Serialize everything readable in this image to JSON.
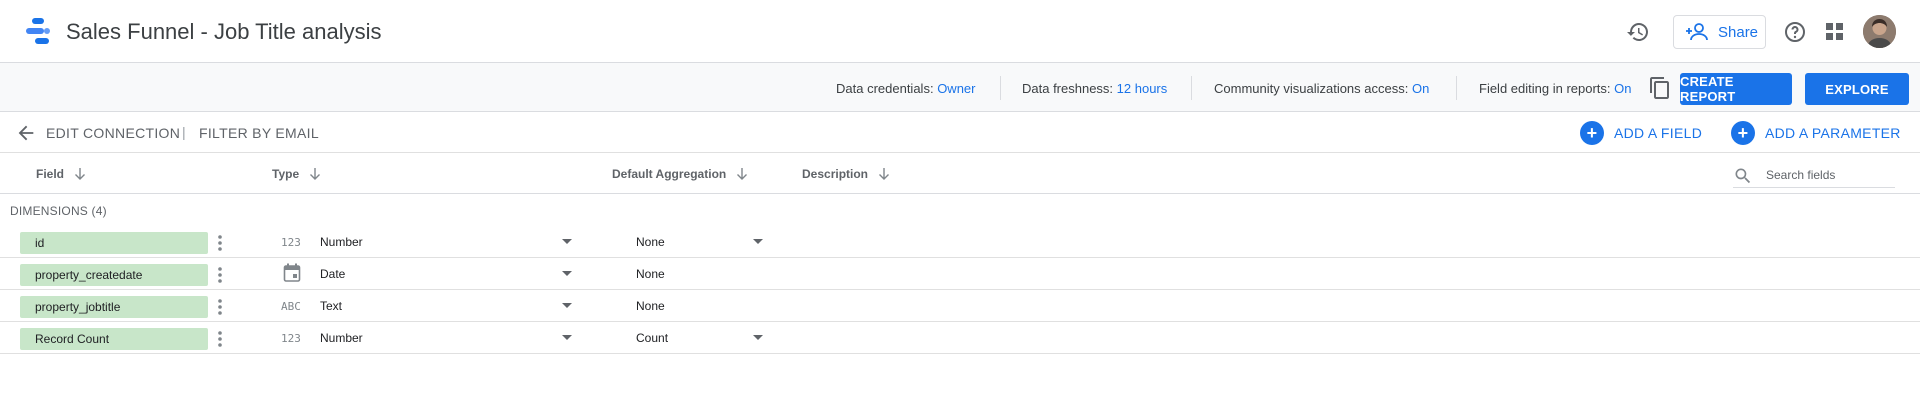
{
  "header": {
    "title": "Sales Funnel - Job Title analysis",
    "share_label": "Share",
    "icons": [
      "history-icon",
      "help-icon",
      "apps-grid-icon"
    ]
  },
  "infobar": {
    "credentials_label": "Data credentials:",
    "credentials_value": "Owner",
    "freshness_label": "Data freshness:",
    "freshness_value": "12 hours",
    "community_label": "Community visualizations access:",
    "community_value": "On",
    "field_editing_label": "Field editing in reports:",
    "field_editing_value": "On",
    "create_report_label": "CREATE REPORT",
    "explore_label": "EXPLORE"
  },
  "connection": {
    "edit_label": "EDIT CONNECTION",
    "separator": "|",
    "filter_label": "FILTER BY EMAIL",
    "add_field_label": "ADD A FIELD",
    "add_parameter_label": "ADD A PARAMETER"
  },
  "columns": {
    "field": "Field",
    "type": "Type",
    "aggregation": "Default Aggregation",
    "description": "Description"
  },
  "search": {
    "placeholder": "Search fields"
  },
  "dimensions": {
    "label": "DIMENSIONS (4)",
    "rows": [
      {
        "name": "id",
        "type_icon": "123",
        "type": "Number",
        "aggregation": "None",
        "agg_dropdown": true
      },
      {
        "name": "property_createdate",
        "type_icon": "calendar-icon",
        "type": "Date",
        "aggregation": "None",
        "agg_dropdown": false
      },
      {
        "name": "property_jobtitle",
        "type_icon": "ABC",
        "type": "Text",
        "aggregation": "None",
        "agg_dropdown": false
      },
      {
        "name": "Record Count",
        "type_icon": "123",
        "type": "Number",
        "aggregation": "Count",
        "agg_dropdown": true
      }
    ]
  },
  "colors": {
    "accent": "#1a73e8",
    "dimension_chip": "#c8e6c9"
  }
}
